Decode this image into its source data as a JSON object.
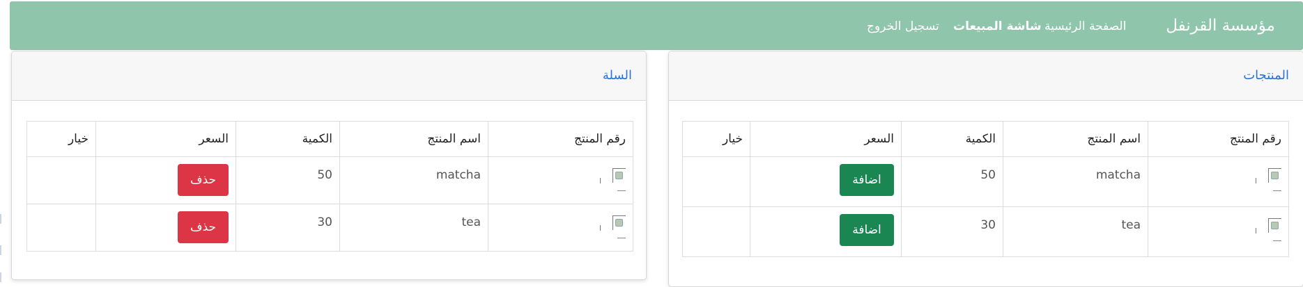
{
  "navbar": {
    "brand": "مؤسسة القرنفل",
    "links": [
      {
        "label": "الصفحة الرئيسية",
        "active": false
      },
      {
        "label": "شاشة المبيعات",
        "active": true
      },
      {
        "label": "تسجيل الخروج",
        "active": false
      }
    ]
  },
  "products": {
    "title": "المنتجات",
    "headers": [
      "رقم المنتج",
      "اسم المنتج",
      "الكمية",
      "السعر",
      "خيار"
    ],
    "rows": [
      {
        "name": "matcha",
        "qty": "50",
        "action": "اضافة"
      },
      {
        "name": "tea",
        "qty": "30",
        "action": "اضافة"
      }
    ]
  },
  "cart": {
    "title": "السلة",
    "headers": [
      "رقم المنتج",
      "اسم المنتج",
      "الكمية",
      "السعر",
      "خيار"
    ],
    "rows": [
      {
        "name": "matcha",
        "qty": "50",
        "action": "حذف"
      },
      {
        "name": "tea",
        "qty": "30",
        "action": "حذف"
      }
    ]
  },
  "colors": {
    "navbar": "#8fc5ab",
    "add_button": "#1a8753",
    "delete_button": "#dc3545",
    "card_title": "#2a72d9"
  }
}
